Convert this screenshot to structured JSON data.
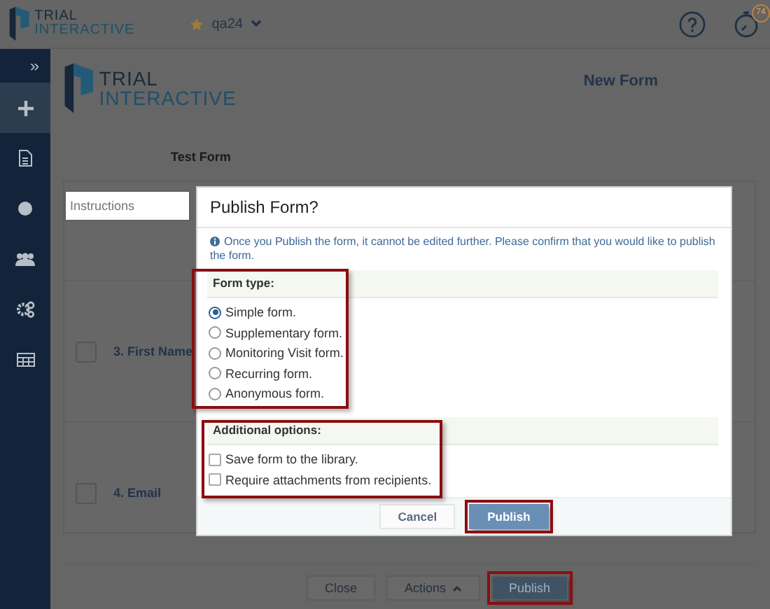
{
  "header": {
    "brand_top": "TRIAL",
    "brand_bottom": "INTERACTIVE",
    "study": "qa24",
    "timer_badge": "74"
  },
  "sidebar": {
    "toggle": "»",
    "items": [
      {
        "kind": "add",
        "selected": true
      },
      {
        "kind": "document",
        "selected": false
      },
      {
        "kind": "circle",
        "selected": false
      },
      {
        "kind": "people",
        "selected": false
      },
      {
        "kind": "gears",
        "selected": false
      },
      {
        "kind": "grid",
        "selected": false
      }
    ]
  },
  "form": {
    "brand_top": "TRIAL",
    "brand_bottom": "INTERACTIVE",
    "title": "New Form",
    "name": "Test Form",
    "instructions_placeholder": "Instructions",
    "questions": [
      {
        "label": "3. First Name",
        "checked": false
      },
      {
        "label": "4. Email",
        "checked": false
      }
    ]
  },
  "footer_buttons": [
    {
      "label": "Close",
      "kind": "plain",
      "highlighted": false
    },
    {
      "label": "Actions",
      "kind": "menu",
      "highlighted": false
    },
    {
      "label": "Publish",
      "kind": "primary",
      "highlighted": true
    }
  ],
  "dialog": {
    "title": "Publish Form?",
    "notice": "Once you Publish the form, it cannot be edited further. Please confirm that you would like to publish the form.",
    "form_type": {
      "label": "Form type:",
      "highlighted": true,
      "options": [
        {
          "label": "Simple form.",
          "selected": true
        },
        {
          "label": "Supplementary form.",
          "selected": false
        },
        {
          "label": "Monitoring Visit form.",
          "selected": false
        },
        {
          "label": "Recurring form.",
          "selected": false
        },
        {
          "label": "Anonymous form.",
          "selected": false
        }
      ]
    },
    "additional": {
      "label": "Additional options:",
      "highlighted": true,
      "options": [
        {
          "label": "Save form to the library.",
          "checked": false
        },
        {
          "label": "Require attachments from recipients.",
          "checked": false
        }
      ]
    },
    "buttons": [
      {
        "label": "Cancel",
        "kind": "secondary",
        "highlighted": false
      },
      {
        "label": "Publish",
        "kind": "primary",
        "highlighted": true
      }
    ]
  }
}
